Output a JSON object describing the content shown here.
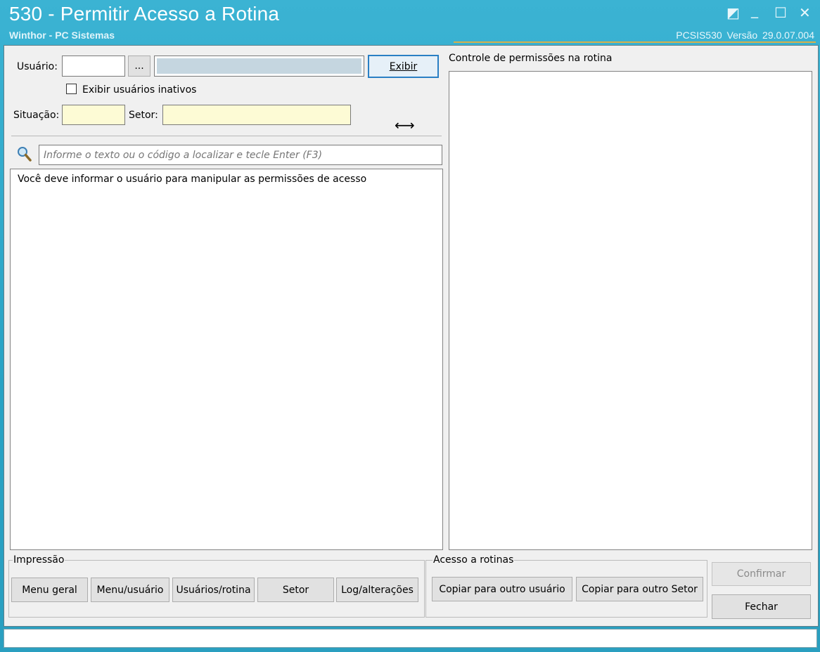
{
  "window": {
    "title": "530 - Permitir Acesso a Rotina",
    "subtitle": "Winthor - PC Sistemas",
    "version": "PCSIS530  Versão  29.0.07.004",
    "controls": {
      "restore": "◩",
      "minimize": "_",
      "maximize": "☐",
      "close": "✕"
    }
  },
  "form": {
    "usuario_label": "Usuário:",
    "usuario_code": "",
    "usuario_ellipsis": "...",
    "usuario_name": "",
    "exibir_button": "Exibir",
    "inativos_label": "Exibir usuários inativos",
    "situacao_label": "Situação:",
    "situacao_value": "",
    "setor_label": "Setor:",
    "setor_value": ""
  },
  "search": {
    "placeholder": "Informe o texto ou o código a localizar e tecle Enter (F3)"
  },
  "left_list": {
    "message": "Você deve informar o usuário para manipular as permissões de acesso"
  },
  "right_panel": {
    "title": "Controle de permissões na rotina"
  },
  "impressao": {
    "label": "Impressão",
    "buttons": [
      "Menu geral",
      "Menu/usuário",
      "Usuários/rotina",
      "Setor",
      "Log/alterações"
    ]
  },
  "acesso": {
    "label": "Acesso a rotinas",
    "buttons": [
      "Copiar para outro usuário",
      "Copiar para outro Setor"
    ]
  },
  "actions": {
    "confirmar": "Confirmar",
    "fechar": "Fechar"
  },
  "colors": {
    "titlebar": "#2aa0c0",
    "input_required": "#fdfbd5",
    "accent_line": "#d7b04a",
    "focus_border": "#2a7fc4"
  }
}
